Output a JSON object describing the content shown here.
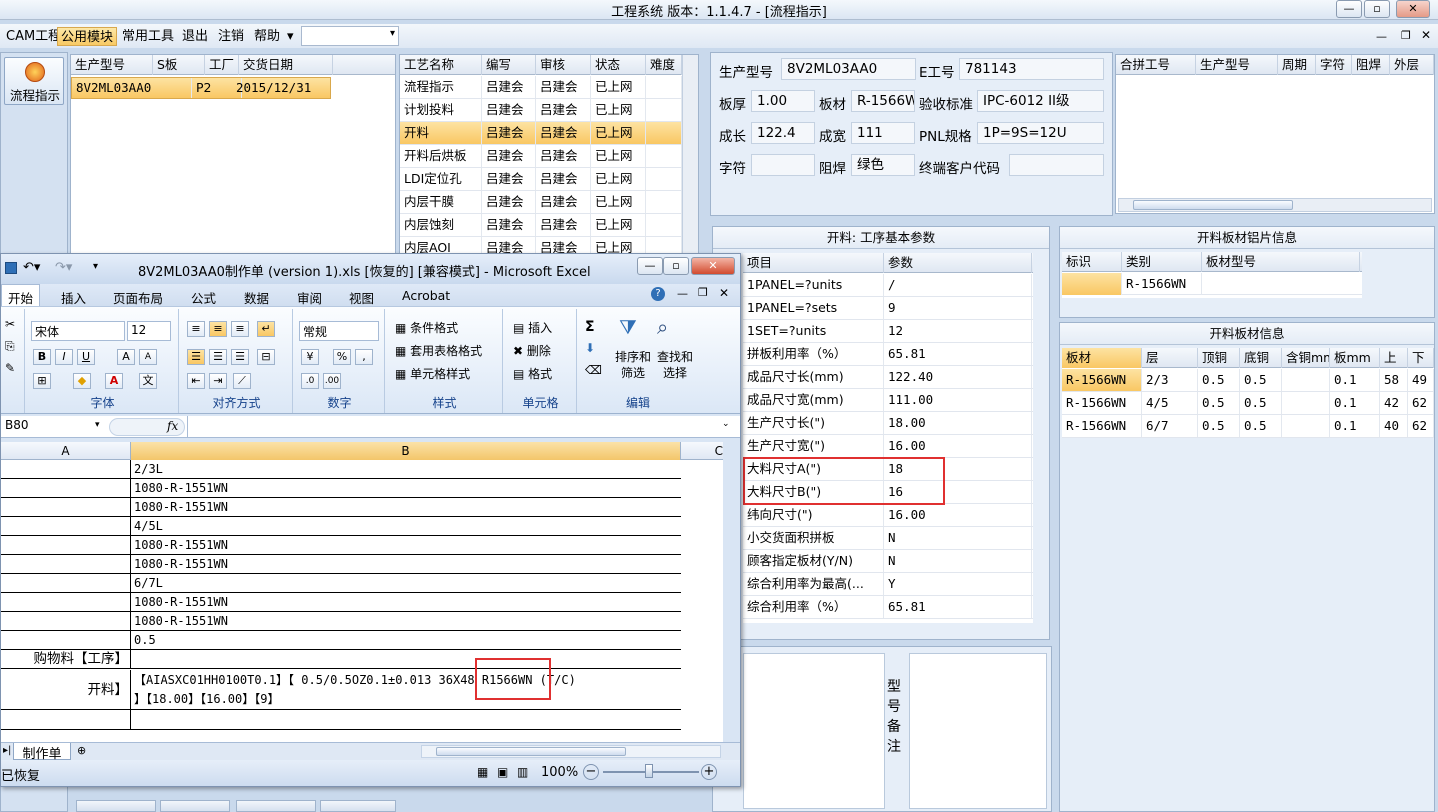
{
  "app": {
    "title": "工程系统   版本：1.1.4.7 - [流程指示]",
    "win_min": "—",
    "win_max": "▫",
    "win_close": "✕"
  },
  "menu": {
    "items": [
      "CAM工程",
      "公用模块",
      "常用工具",
      "退出",
      "注销",
      "帮助"
    ],
    "active": "公用模块",
    "help_arrow": "▾"
  },
  "sidebar": {
    "flow_button": "流程指示"
  },
  "order_grid": {
    "headers": [
      "生产型号",
      "S板",
      "工厂",
      "交货日期"
    ],
    "rows": [
      [
        "8V2ML03AA0",
        "",
        "P2",
        "2015/12/31"
      ]
    ]
  },
  "process_grid": {
    "headers": [
      "工艺名称",
      "编写",
      "审核",
      "状态",
      "难度"
    ],
    "rows": [
      [
        "流程指示",
        "吕建会",
        "吕建会",
        "已上网",
        ""
      ],
      [
        "计划投料",
        "吕建会",
        "吕建会",
        "已上网",
        ""
      ],
      [
        "开料",
        "吕建会",
        "吕建会",
        "已上网",
        ""
      ],
      [
        "开料后烘板",
        "吕建会",
        "吕建会",
        "已上网",
        ""
      ],
      [
        "LDI定位孔",
        "吕建会",
        "吕建会",
        "已上网",
        ""
      ],
      [
        "内层干膜",
        "吕建会",
        "吕建会",
        "已上网",
        ""
      ],
      [
        "内层蚀刻",
        "吕建会",
        "吕建会",
        "已上网",
        ""
      ],
      [
        "内层AOI",
        "吕建会",
        "吕建会",
        "已上网",
        ""
      ]
    ],
    "selected_row": "开料"
  },
  "info": {
    "model_label": "生产型号",
    "model_value": "8V2ML03AA0",
    "e_label": "E工号",
    "e_value": "781143",
    "thickness_label": "板厚",
    "thickness_value": "1.00",
    "material_label": "板材",
    "material_value": "R-1566W",
    "standard_label": "验收标准",
    "standard_value": "IPC-6012 II级",
    "length_label": "成长",
    "length_value": "122.4",
    "width_label": "成宽",
    "width_value": "111",
    "pnl_label": "PNL规格",
    "pnl_value": "1P=9S=12U",
    "char_label": "字符",
    "char_value": "",
    "mask_label": "阻焊",
    "mask_value": "绿色",
    "customer_label": "终端客户代码",
    "customer_value": ""
  },
  "merge_grid": {
    "headers": [
      "合拼工号",
      "生产型号",
      "周期",
      "字符",
      "阻焊",
      "外层"
    ]
  },
  "param_panel": {
    "title": "开料: 工序基本参数",
    "headers": [
      "项目",
      "参数"
    ],
    "rows": [
      [
        "1PANEL=?units",
        "/"
      ],
      [
        "1PANEL=?sets",
        "9"
      ],
      [
        "1SET=?units",
        "12"
      ],
      [
        "拼板利用率（%）",
        "65.81"
      ],
      [
        "成品尺寸长(mm)",
        "122.40"
      ],
      [
        "成品尺寸宽(mm)",
        "111.00"
      ],
      [
        "生产尺寸长(\")",
        "18.00"
      ],
      [
        "生产尺寸宽(\")",
        "16.00"
      ],
      [
        "大料尺寸A(\")",
        "18"
      ],
      [
        "大料尺寸B(\")",
        "16"
      ],
      [
        "纬向尺寸(\")",
        "16.00"
      ],
      [
        "小交货面积拼板",
        "N"
      ],
      [
        "顾客指定板材(Y/N)",
        "N"
      ],
      [
        "综合利用率为最高(...",
        "Y"
      ],
      [
        "综合利用率（%）",
        "65.81"
      ]
    ]
  },
  "copper_panel": {
    "title": "开料板材铝片信息",
    "headers": [
      "标识",
      "类别",
      "板材型号"
    ],
    "rows": [
      [
        "",
        "R-1566WN",
        ""
      ]
    ]
  },
  "material_panel": {
    "title": "开料板材信息",
    "headers": [
      "板材",
      "层",
      "顶铜",
      "底铜",
      "含铜mm",
      "板mm",
      "上",
      "下"
    ],
    "rows": [
      [
        "R-1566WN",
        "2/3",
        "0.5",
        "0.5",
        "",
        "0.1",
        "58",
        "49"
      ],
      [
        "R-1566WN",
        "4/5",
        "0.5",
        "0.5",
        "",
        "0.1",
        "42",
        "62"
      ],
      [
        "R-1566WN",
        "6/7",
        "0.5",
        "0.5",
        "",
        "0.1",
        "40",
        "62"
      ]
    ]
  },
  "remark": {
    "label": "型号备注"
  },
  "excel": {
    "title": "8V2ML03AA0制作单 (version 1).xls [恢复的]  [兼容模式] - Microsoft Excel",
    "tabs": [
      "开始",
      "插入",
      "页面布局",
      "公式",
      "数据",
      "审阅",
      "视图",
      "Acrobat"
    ],
    "font_name": "宋体",
    "font_size": "12",
    "number_format": "常规",
    "groups": [
      "字体",
      "对齐方式",
      "数字",
      "样式",
      "单元格",
      "编辑"
    ],
    "style_buttons": [
      "条件格式",
      "套用表格格式",
      "单元格样式"
    ],
    "cell_buttons": [
      "插入",
      "删除",
      "格式"
    ],
    "edit_buttons": [
      "排序和筛选",
      "查找和选择"
    ],
    "name_box": "B80",
    "fx": "fx",
    "col_a": "A",
    "col_b": "B",
    "col_c": "C",
    "rows": [
      [
        "",
        "2/3L"
      ],
      [
        "",
        "1080-R-1551WN"
      ],
      [
        "",
        "1080-R-1551WN"
      ],
      [
        "",
        "4/5L"
      ],
      [
        "",
        "1080-R-1551WN"
      ],
      [
        "",
        "1080-R-1551WN"
      ],
      [
        "",
        "6/7L"
      ],
      [
        "",
        "1080-R-1551WN"
      ],
      [
        "",
        "1080-R-1551WN"
      ],
      [
        "",
        "0.5"
      ],
      [
        "购物料【工序】",
        ""
      ]
    ],
    "big_row_a": "开料】",
    "big_row_b1": "【AIASXC01HH0100T0.1】【 0.5/0.5OZ0.1±0.013 36X48  R1566WN (T/C)",
    "big_row_b2": "】【18.00】【16.00】【9】",
    "sheet_tab": "制作单",
    "status": "已恢复",
    "zoom": "100%"
  }
}
